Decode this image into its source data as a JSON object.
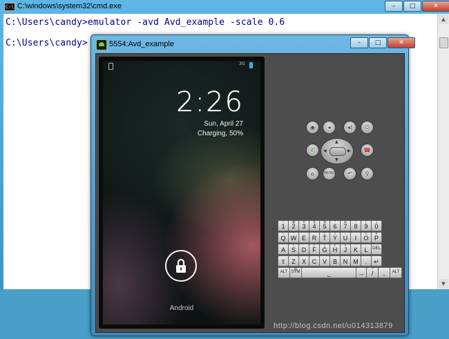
{
  "cmd": {
    "title": "C:\\windows\\system32\\cmd.exe",
    "icon_text": "C:\\",
    "lines": [
      "C:\\Users\\candy>emulator -avd Avd_example -scale 0.6",
      "C:\\Users\\candy>"
    ],
    "controls": {
      "minimize": "–",
      "maximize": "□",
      "close": "✕"
    }
  },
  "emulator": {
    "title": "5554:Avd_example",
    "controls": {
      "minimize": "–",
      "maximize": "□",
      "close": "✕"
    },
    "screen": {
      "status": {
        "signal": "3G"
      },
      "clock": "2:26",
      "date": "Sun, April 27",
      "charging": "Charging, 50%",
      "carrier": "Android"
    },
    "buttons": {
      "row1": [
        "camera-icon",
        "volume-down-icon",
        "volume-up-icon",
        "power-icon"
      ],
      "row2": [
        "call-icon",
        "dpad",
        "end-call-icon"
      ],
      "row3": [
        "home-icon",
        "menu-button",
        "back-icon",
        "search-icon"
      ],
      "menu_label": "MENU",
      "icons": {
        "camera": "◉",
        "vol_down": "◂",
        "vol_up": "◂)",
        "power": "⏻",
        "home": "⌂",
        "back": "↶",
        "search": "⚲",
        "call": "✆",
        "end_call": "☎"
      }
    },
    "keyboard": {
      "rows": [
        [
          [
            "1",
            "!"
          ],
          [
            "2",
            "@"
          ],
          [
            "3",
            "#"
          ],
          [
            "4",
            "$"
          ],
          [
            "5",
            "%"
          ],
          [
            "6",
            "^"
          ],
          [
            "7",
            "&"
          ],
          [
            "8",
            "*"
          ],
          [
            "9",
            "("
          ],
          [
            "0",
            ")"
          ]
        ],
        [
          [
            "Q",
            "~"
          ],
          [
            "W",
            "\""
          ],
          [
            "E",
            "´"
          ],
          [
            "R",
            ""
          ],
          [
            "T",
            "{"
          ],
          [
            "Y",
            "}"
          ],
          [
            "U",
            "-"
          ],
          [
            "I",
            ""
          ],
          [
            "O",
            "+"
          ],
          [
            "P",
            "="
          ]
        ],
        [
          [
            "A",
            ""
          ],
          [
            "S",
            "\\"
          ],
          [
            "D",
            ""
          ],
          [
            "F",
            "["
          ],
          [
            "G",
            "]"
          ],
          [
            "H",
            "<"
          ],
          [
            "J",
            ">"
          ],
          [
            "K",
            ";"
          ],
          [
            "L",
            ":"
          ],
          [
            "DEL",
            ""
          ]
        ],
        [
          [
            "⇧",
            ""
          ],
          [
            "Z",
            ""
          ],
          [
            "X",
            ""
          ],
          [
            "C",
            ""
          ],
          [
            "V",
            ""
          ],
          [
            "B",
            ""
          ],
          [
            "N",
            ""
          ],
          [
            "M",
            ""
          ],
          [
            ".",
            ""
          ],
          [
            "↵",
            ""
          ]
        ],
        [
          [
            "ALT",
            ""
          ],
          [
            "SYM",
            "@"
          ],
          [
            "⎵",
            ""
          ],
          [
            "→",
            ""
          ],
          [
            "/",
            "?"
          ],
          [
            ",",
            ""
          ],
          [
            "ALT",
            ""
          ]
        ]
      ]
    }
  },
  "watermark": "http://blog.csdn.net/u014313879"
}
